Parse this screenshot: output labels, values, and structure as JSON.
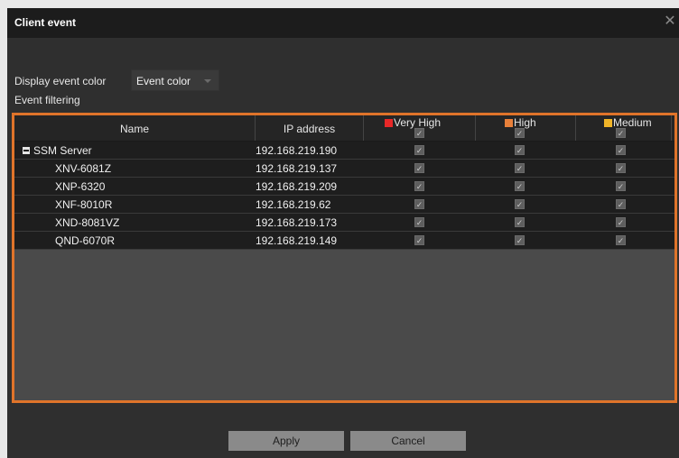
{
  "dialog": {
    "title": "Client event",
    "close_glyph": "✕"
  },
  "display": {
    "label": "Display event color",
    "dropdown_value": "Event color"
  },
  "filtering": {
    "label": "Event filtering"
  },
  "columns": {
    "name": "Name",
    "ip": "IP address",
    "very_high": {
      "label": "Very High",
      "color": "#e82828"
    },
    "high": {
      "label": "High",
      "color": "#e8803a"
    },
    "medium": {
      "label": "Medium",
      "color": "#f0b428"
    }
  },
  "check_glyph": "✓",
  "rows": [
    {
      "name": "SSM Server",
      "ip": "192.168.219.190",
      "very_high": true,
      "high": true,
      "medium": true,
      "group": true
    },
    {
      "name": "XNV-6081Z",
      "ip": "192.168.219.137",
      "very_high": true,
      "high": true,
      "medium": true
    },
    {
      "name": "XNP-6320",
      "ip": "192.168.219.209",
      "very_high": true,
      "high": true,
      "medium": true
    },
    {
      "name": "XNF-8010R",
      "ip": "192.168.219.62",
      "very_high": true,
      "high": true,
      "medium": true
    },
    {
      "name": "XND-8081VZ",
      "ip": "192.168.219.173",
      "very_high": true,
      "high": true,
      "medium": true
    },
    {
      "name": "QND-6070R",
      "ip": "192.168.219.149",
      "very_high": true,
      "high": true,
      "medium": true
    }
  ],
  "buttons": {
    "apply": "Apply",
    "cancel": "Cancel"
  }
}
